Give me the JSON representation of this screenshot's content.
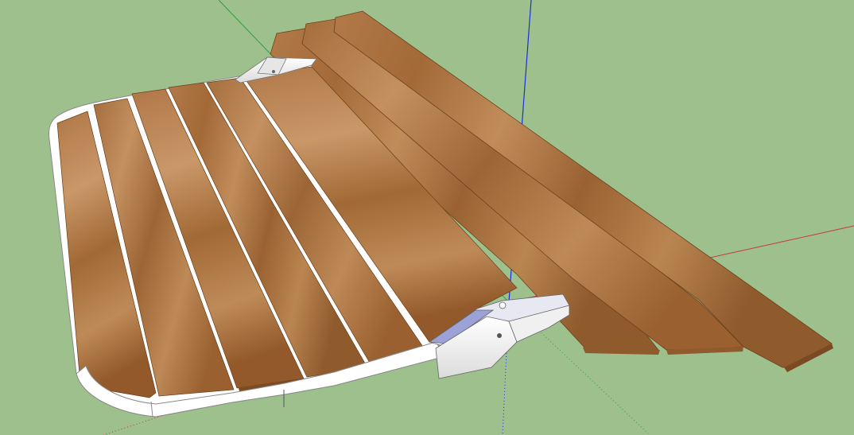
{
  "viewport": {
    "background": "#9dc08d",
    "axis_colors": {
      "red": "#c8383a",
      "green": "#2fa043",
      "blue": "#1a2fd8"
    }
  },
  "model": {
    "wood_light": "#bb8a5c",
    "wood_mid": "#a06a3a",
    "wood_dark": "#7a4b23",
    "frame_color": "#ffffff",
    "bracket_color": "#f4f4f4"
  }
}
